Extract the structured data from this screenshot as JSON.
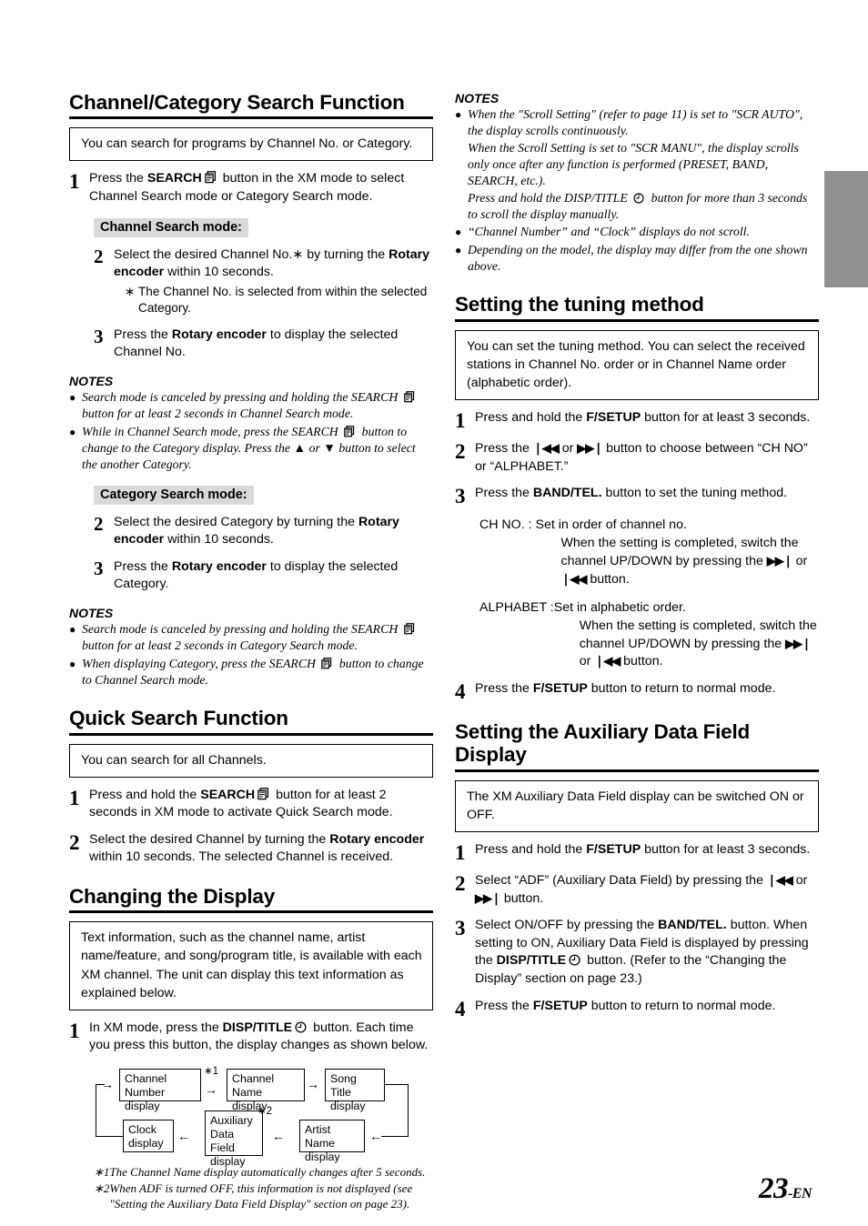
{
  "page": {
    "number": "23",
    "lang_suffix": "-EN",
    "edge_tab_color": "#919191"
  },
  "icons": {
    "search": "search-list-icon",
    "clock": "clock-icon",
    "skip_back": "❘◀◀",
    "skip_fwd": "▶▶❘"
  },
  "left_column": {
    "section1": {
      "title": "Channel/Category Search Function",
      "callout": "You can search for programs by Channel No. or Category.",
      "step1": {
        "num": "1",
        "text_a": "Press the ",
        "bold_a": "SEARCH",
        "text_b": " button in the XM mode to select Channel Search mode or Category Search mode."
      },
      "channel_mode_label": "Channel Search mode:",
      "ch_step2": {
        "num": "2",
        "text_a": "Select the desired Channel No.∗ by turning the ",
        "bold_a": "Rotary encoder",
        "text_b": " within 10 seconds."
      },
      "ch_step2_note": {
        "marker": "∗",
        "text": "The Channel No. is selected from within the selected Category."
      },
      "ch_step3": {
        "num": "3",
        "text_a": "Press the ",
        "bold_a": "Rotary encoder",
        "text_b": " to display the selected Channel No."
      },
      "notes_head_1": "NOTES",
      "notes_1": [
        {
          "part_a": "Search mode is canceled by pressing and holding the SEARCH ",
          "part_b": " button for at least 2 seconds in Channel Search mode."
        },
        {
          "part_a": "While in Channel Search mode, press the SEARCH ",
          "part_b": " button to change to the Category display. Press the ▲ or ▼ button to select the another Category."
        }
      ],
      "category_mode_label": "Category Search mode:",
      "cat_step2": {
        "num": "2",
        "text_a": "Select the desired Category by turning the ",
        "bold_a": "Rotary encoder",
        "text_b": " within 10 seconds."
      },
      "cat_step3": {
        "num": "3",
        "text_a": "Press the ",
        "bold_a": "Rotary encoder",
        "text_b": " to display the selected Category."
      },
      "notes_head_2": "NOTES",
      "notes_2": [
        {
          "part_a": "Search mode is canceled by pressing and holding the SEARCH ",
          "part_b": " button for at least 2 seconds in Category Search mode."
        },
        {
          "part_a": "When displaying Category, press the SEARCH ",
          "part_b": " button to change to Channel Search mode."
        }
      ]
    },
    "section2": {
      "title": "Quick Search Function",
      "callout": "You can search for all Channels.",
      "step1": {
        "num": "1",
        "text_a": "Press and hold the ",
        "bold_a": "SEARCH",
        "text_b": " button for at least 2 seconds in XM mode to activate Quick Search mode."
      },
      "step2": {
        "num": "2",
        "text_a": "Select the desired Channel by turning the ",
        "bold_a": "Rotary encoder",
        "text_b": " within 10 seconds. The selected Channel is received."
      }
    },
    "section3": {
      "title": "Changing the Display",
      "callout": "Text information, such as the channel name, artist name/feature, and song/program title, is available with each XM channel. The unit can display this text information as explained below.",
      "step1": {
        "num": "1",
        "text_a": "In XM mode, press the ",
        "bold_a": "DISP/TITLE",
        "text_b": " button. Each time you press this button, the display changes as shown below."
      },
      "flow": {
        "boxes": [
          {
            "id": "channel-number",
            "line1": "Channel Number",
            "line2": "display"
          },
          {
            "id": "channel-name",
            "line1": "Channel Name",
            "line2": "display"
          },
          {
            "id": "song-title",
            "line1": "Song Title",
            "line2": "display"
          },
          {
            "id": "artist-name",
            "line1": "Artist Name",
            "line2": "display"
          },
          {
            "id": "auxiliary-data-field",
            "line1": "Auxiliary",
            "line2": "Data Field",
            "line3": "display"
          },
          {
            "id": "clock",
            "line1": "Clock",
            "line2": "display"
          }
        ],
        "star1": "∗1",
        "star2": "∗2"
      },
      "footnotes": [
        {
          "marker": "∗1",
          "text": "The Channel Name display automatically changes after 5 seconds."
        },
        {
          "marker": "∗2",
          "text": "When ADF is turned OFF, this information is not displayed (see \"Setting the Auxiliary Data Field Display\" section on page 23)."
        }
      ]
    }
  },
  "right_column": {
    "notes_top": {
      "head": "NOTES",
      "items": [
        {
          "p1_a": "When the \"Scroll Setting\" (refer to page 11) is set to \"SCR AUTO\", the display scrolls continuously.",
          "p2": "When the Scroll Setting is set to \"SCR MANU\", the display scrolls only once after any function is performed (PRESET, BAND, SEARCH, etc.).",
          "p3_a": "Press and hold the DISP/TITLE ",
          "p3_b": " button for more than 3 seconds to scroll the display manually."
        },
        {
          "p1_a": "“Channel Number” and “Clock” displays do not scroll."
        },
        {
          "p1_a": "Depending on the model, the display may differ from the one shown above."
        }
      ]
    },
    "section_tuning": {
      "title": "Setting the tuning method",
      "callout": "You can set the tuning method. You can select the received stations in Channel No. order or in Channel Name order (alphabetic order).",
      "step1": {
        "num": "1",
        "text_a": "Press and hold the ",
        "bold_a": "F/SETUP",
        "text_b": " button for at least 3 seconds."
      },
      "step2": {
        "num": "2",
        "text_a": "Press the ",
        "mid": " or ",
        "text_b": " button to choose between “CH NO” or “ALPHABET.”"
      },
      "step3": {
        "num": "3",
        "text_a": "Press the ",
        "bold_a": "BAND/TEL.",
        "text_b": " button to set the tuning method."
      },
      "def_chno": {
        "term": "CH NO. : ",
        "line1": "Set in order of channel no.",
        "cont_a": "When the setting is completed, switch the channel UP/DOWN by pressing the ",
        "cont_mid": " or ",
        "cont_b": " button."
      },
      "def_alphabet": {
        "term": "ALPHABET :",
        "line1": "Set in alphabetic order.",
        "cont_a": "When the setting is completed, switch the channel UP/DOWN by pressing the ",
        "cont_mid": " or ",
        "cont_b": " button."
      },
      "step4": {
        "num": "4",
        "text_a": "Press the ",
        "bold_a": "F/SETUP",
        "text_b": " button to return to normal mode."
      }
    },
    "section_adf": {
      "title": "Setting the Auxiliary Data Field Display",
      "callout": "The XM Auxiliary Data Field display can be switched ON or OFF.",
      "step1": {
        "num": "1",
        "text_a": "Press and hold the ",
        "bold_a": "F/SETUP",
        "text_b": " button for at least 3 seconds."
      },
      "step2": {
        "num": "2",
        "text_a": "Select “ADF” (Auxiliary Data Field) by pressing the ",
        "mid": " or ",
        "text_b": " button."
      },
      "step3": {
        "num": "3",
        "text_a": "Select ON/OFF by pressing the ",
        "bold_a": "BAND/TEL.",
        "text_b": " button. When setting to ON, Auxiliary Data Field is displayed by pressing the ",
        "bold_b": "DISP/TITLE",
        "text_c": " button. (Refer to the “Changing the Display” section on page 23.)"
      },
      "step4": {
        "num": "4",
        "text_a": "Press the ",
        "bold_a": "F/SETUP",
        "text_b": " button to return to normal mode."
      }
    }
  }
}
